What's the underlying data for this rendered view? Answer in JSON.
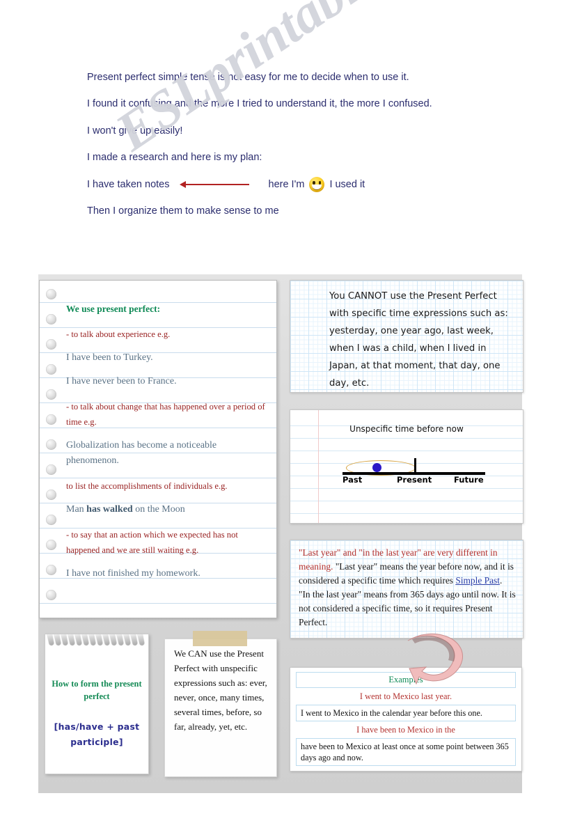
{
  "watermark": "ESLprintables.com",
  "intro": {
    "line1": "Present perfect simple tense is not easy for me to decide when to use it.",
    "line2": "I found it confusing and the more I tried to understand it, the more I confused.",
    "line3": "I won't give up easily!",
    "line4": "I made a research and here is my plan:",
    "line5_left": "I have taken notes",
    "line5_mid": "here I'm",
    "line5_right": "I used it",
    "line6": "Then I organize them to make sense to me"
  },
  "notepad_main": {
    "title": "We use present perfect:",
    "items": [
      {
        "type": "rule",
        "text": "- to talk about experience e.g."
      },
      {
        "type": "example",
        "text": "I have been to Turkey."
      },
      {
        "type": "example",
        "text": "I have never been to France."
      },
      {
        "type": "rule",
        "text": "- to talk about change that has happened over a period of time e.g."
      },
      {
        "type": "example",
        "text": "Globalization has become a noticeable phenomenon."
      },
      {
        "type": "rule",
        "text": "to list the accomplishments of individuals e.g."
      },
      {
        "type": "example_bold",
        "pre": "Man ",
        "bold": "has walked",
        "post": " on the Moon"
      },
      {
        "type": "rule",
        "text": "- to say that an action which we expected has not happened and we are still waiting e.g."
      },
      {
        "type": "example",
        "text": "I have not finished my homework."
      }
    ]
  },
  "cannot_box": {
    "text": "You CANNOT use the Present Perfect with specific time expressions such as: yesterday, one year ago, last week, when I was a child, when I lived in Japan, at that moment, that day, one day, etc."
  },
  "timeline": {
    "caption": "Unspecific time before now",
    "label_past": "Past",
    "label_present": "Present",
    "label_future": "Future"
  },
  "lastyear_box": {
    "red_part": "\"Last year\" and \"in the last year\" are very different in meaning.",
    "black_part_1": " \"Last year\" means the year before now, and it is considered a specific time which requires ",
    "link": "Simple Past",
    "black_part_2": ". \"In the last year\" means from 365 days ago until now. It is not considered a specific time, so it requires Present Perfect."
  },
  "examples_box": {
    "heading": "Examples",
    "pairs": [
      {
        "question": "I went to Mexico last year.",
        "answer": "I went to Mexico in the calendar year before this one."
      },
      {
        "question": "I have been to Mexico in the",
        "answer": "have been to Mexico at least once at some point between 365 days ago and now."
      }
    ]
  },
  "notepad_small": {
    "title": "How to form the present perfect",
    "formula": "[has/have + past participle]"
  },
  "can_note": {
    "text": "We CAN use the Present Perfect with unspecific expressions such as: ever, never, once, many times, several times, before, so far, already, yet, etc."
  },
  "colors": {
    "heading_green": "#0f8a56",
    "rule_red": "#992222",
    "example_blue_gray": "#5a7286",
    "intro_navy": "#2b2d6e",
    "link_blue": "#2b3fa8",
    "arrow_red": "#b22222",
    "pink_arrow": "#f0bcbc",
    "board_gray": "#d9d9d9",
    "tape_tan": "#d9c79a",
    "timeline_dot": "#2b18c8",
    "timeline_ellipse": "#d6a13c"
  }
}
